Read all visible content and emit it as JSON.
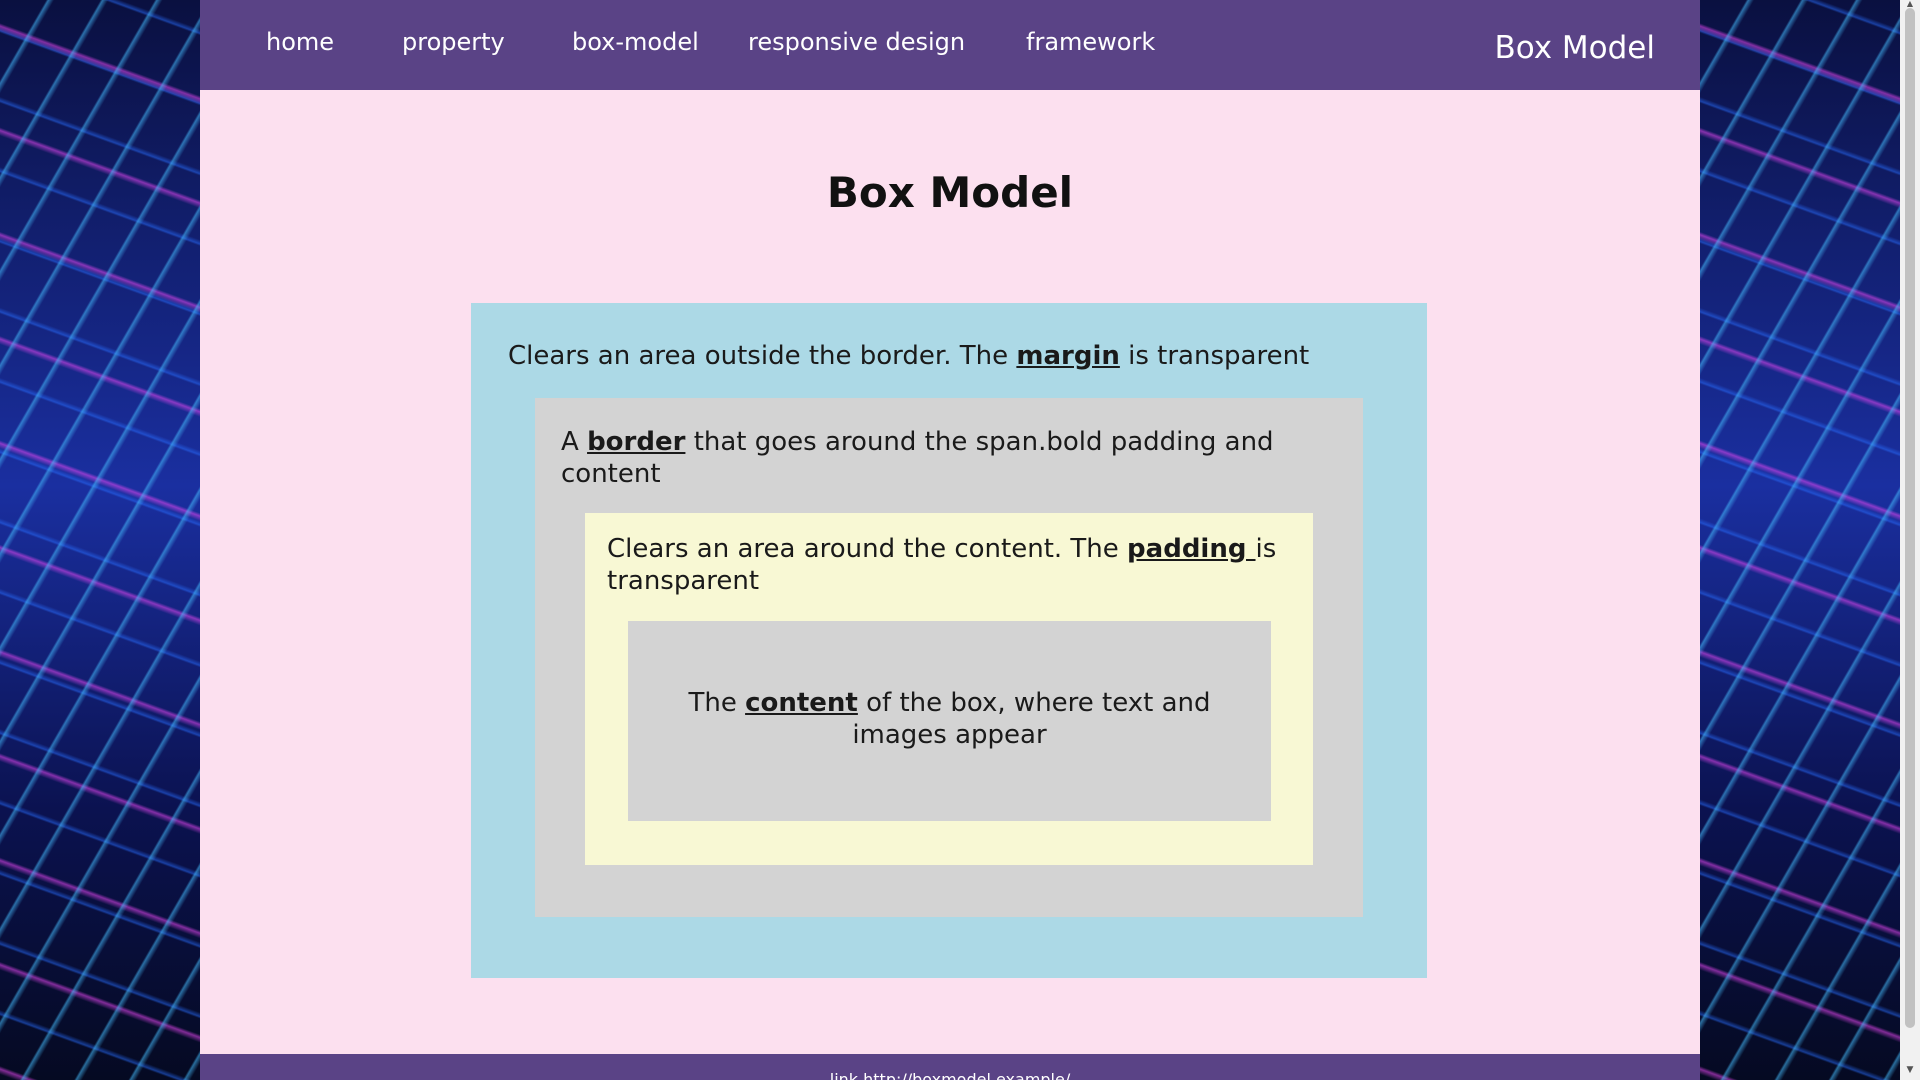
{
  "nav": {
    "items": [
      {
        "label": "home"
      },
      {
        "label": "property"
      },
      {
        "label": "box-model"
      },
      {
        "label": "responsive design"
      },
      {
        "label": "framework"
      }
    ],
    "brand": "Box Model"
  },
  "main": {
    "title": "Box Model",
    "margin_box": {
      "text_before": "Clears an area outside the border. The ",
      "keyword": "margin",
      "text_after": " is transparent",
      "color": "#acd9e6"
    },
    "border_box": {
      "text_before": "A ",
      "keyword": "border",
      "text_after": " that goes around the span.bold padding and content",
      "color": "#d3d3d3"
    },
    "padding_box": {
      "text_before": "Clears an area around the content. The ",
      "keyword": "padding ",
      "text_after": "is transparent",
      "color": "#f8f8d4"
    },
    "content_box": {
      "text_before": "The ",
      "keyword": "content",
      "text_after": " of the box, where text and images appear",
      "color": "#d3d3d3"
    }
  },
  "footer": {
    "text": "link http://boxmodel.example/"
  },
  "colors": {
    "nav_bg": "#5a4386",
    "page_bg": "#fce0ef"
  }
}
